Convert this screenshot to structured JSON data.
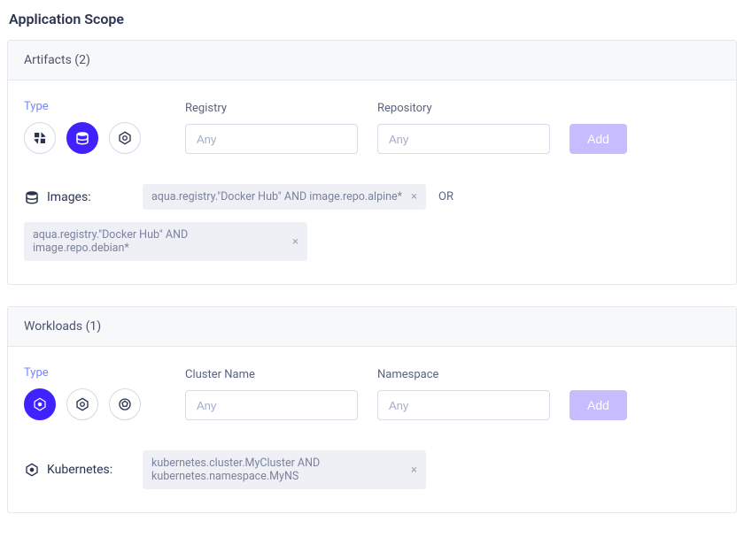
{
  "page_title": "Application Scope",
  "artifacts": {
    "header": "Artifacts (2)",
    "type_label": "Type",
    "registry_label": "Registry",
    "repository_label": "Repository",
    "placeholder": "Any",
    "add_label": "Add",
    "summary_label": "Images:",
    "chips": [
      "aqua.registry.\"Docker Hub\" AND image.repo.alpine*",
      "aqua.registry.\"Docker Hub\" AND image.repo.debian*"
    ],
    "or_label": "OR"
  },
  "workloads": {
    "header": "Workloads (1)",
    "type_label": "Type",
    "cluster_label": "Cluster Name",
    "namespace_label": "Namespace",
    "placeholder": "Any",
    "add_label": "Add",
    "summary_label": "Kubernetes:",
    "chips": [
      "kubernetes.cluster.MyCluster AND kubernetes.namespace.MyNS"
    ]
  }
}
